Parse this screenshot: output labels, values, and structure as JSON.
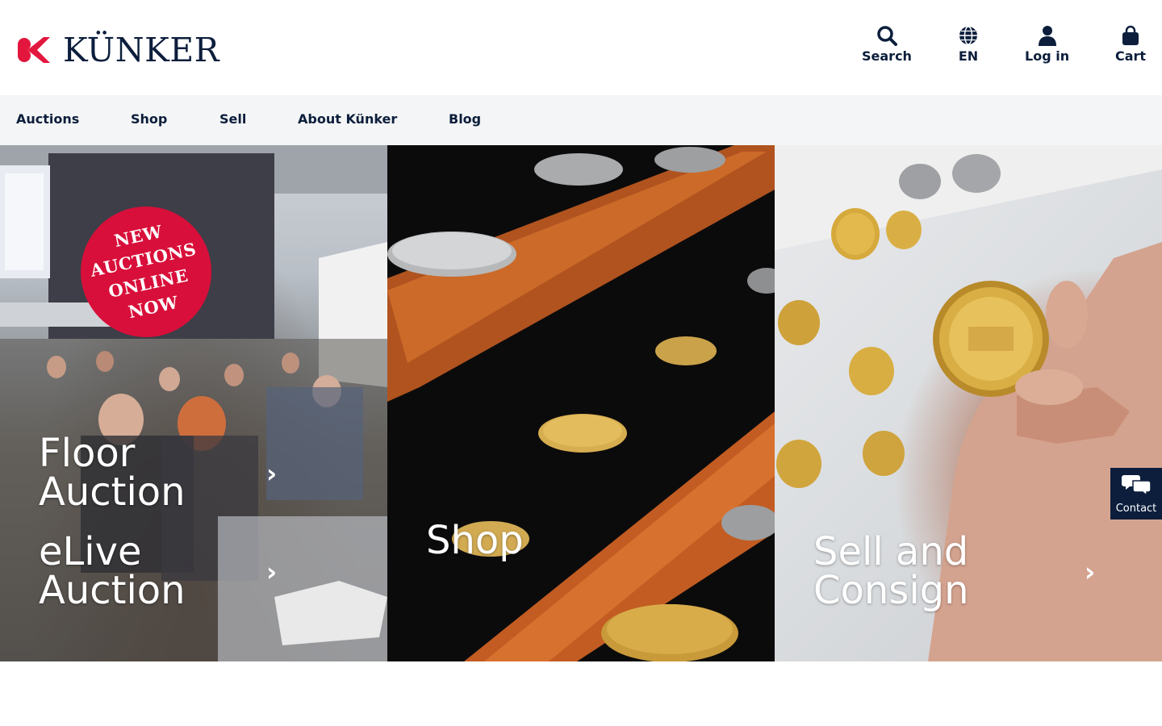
{
  "brand": {
    "name": "KÜNKER",
    "accent": "#e3173e",
    "navy": "#0c1e3c"
  },
  "header": {
    "search_label": "Search",
    "language_label": "EN",
    "login_label": "Log in",
    "cart_label": "Cart"
  },
  "nav": {
    "items": [
      "Auctions",
      "Shop",
      "Sell",
      "About Künker",
      "Blog"
    ]
  },
  "hero": {
    "badge": {
      "line1": "NEW",
      "line2": "AUCTIONS",
      "line3": "ONLINE",
      "line4": "NOW"
    },
    "floor": {
      "line1": "Floor",
      "line2": "Auction"
    },
    "elive": {
      "line1": "eLive",
      "line2": "Auction"
    },
    "shop": {
      "label": "Shop"
    },
    "sell": {
      "line1": "Sell and",
      "line2": "Consign"
    },
    "chevron": "›"
  },
  "contact": {
    "label": "Contact"
  }
}
